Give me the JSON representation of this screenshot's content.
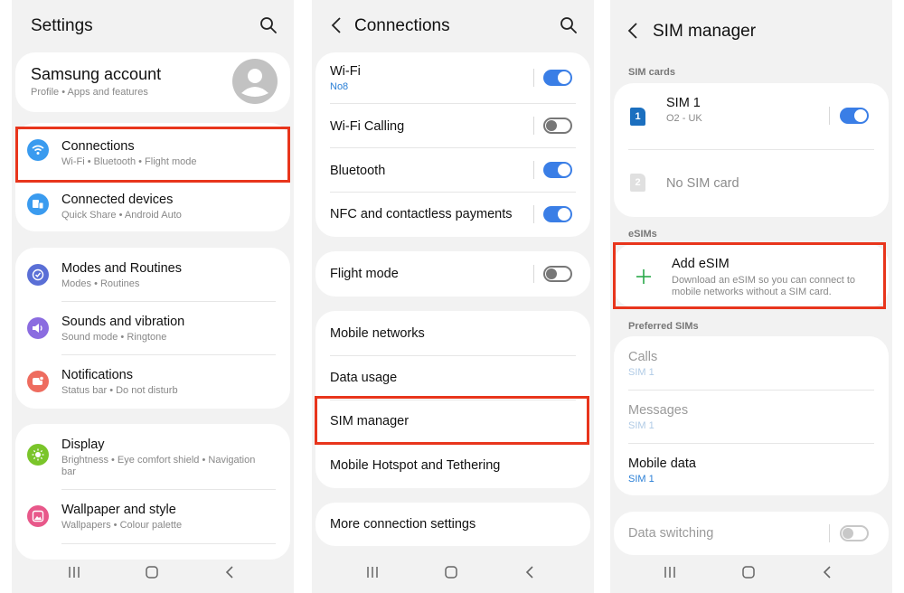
{
  "settings": {
    "title": "Settings",
    "account": {
      "title": "Samsung account",
      "sub": "Profile  •  Apps and features"
    },
    "items": [
      {
        "title": "Connections",
        "sub": "Wi-Fi  •  Bluetooth  •  Flight mode"
      },
      {
        "title": "Connected devices",
        "sub": "Quick Share  •  Android Auto"
      },
      {
        "title": "Modes and Routines",
        "sub": "Modes  •  Routines"
      },
      {
        "title": "Sounds and vibration",
        "sub": "Sound mode  •  Ringtone"
      },
      {
        "title": "Notifications",
        "sub": "Status bar  •  Do not disturb"
      },
      {
        "title": "Display",
        "sub": "Brightness  •  Eye comfort shield  •  Navigation",
        "sub2": "bar"
      },
      {
        "title": "Wallpaper and style",
        "sub": "Wallpapers  •  Colour palette"
      }
    ]
  },
  "connections": {
    "title": "Connections",
    "items": [
      {
        "title": "Wi-Fi",
        "sub": "No8"
      },
      {
        "title": "Wi-Fi Calling"
      },
      {
        "title": "Bluetooth"
      },
      {
        "title": "NFC and contactless payments"
      },
      {
        "title": "Flight mode"
      },
      {
        "title": "Mobile networks"
      },
      {
        "title": "Data usage"
      },
      {
        "title": "SIM manager"
      },
      {
        "title": "Mobile Hotspot and Tethering"
      },
      {
        "title": "More connection settings"
      }
    ]
  },
  "sim": {
    "title": "SIM manager",
    "sec_cards": "SIM cards",
    "sim1": {
      "badge": "1",
      "title": "SIM 1",
      "sub": "O2 - UK"
    },
    "nosim": {
      "badge": "2",
      "title": "No SIM card"
    },
    "sec_esims": "eSIMs",
    "add": {
      "title": "Add eSIM",
      "sub1": "Download an eSIM so you can connect to",
      "sub2": "mobile networks without a SIM card."
    },
    "sec_pref": "Preferred SIMs",
    "calls": {
      "title": "Calls",
      "sub": "SIM 1"
    },
    "messages": {
      "title": "Messages",
      "sub": "SIM 1"
    },
    "data": {
      "title": "Mobile data",
      "sub": "SIM 1"
    },
    "switching": {
      "title": "Data switching"
    }
  },
  "colors": {
    "accent": "#3a7ee6",
    "highlight": "#e8351c"
  }
}
